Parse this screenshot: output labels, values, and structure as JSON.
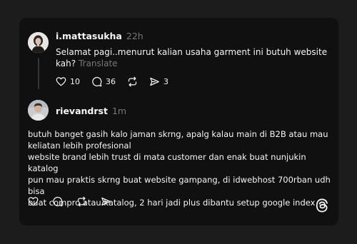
{
  "post1": {
    "username": "i.mattasukha",
    "time": "22h",
    "text_line1": "Selamat pagi..menurut kalian usaha garment ini butuh website",
    "text_line2": "kah?",
    "translate_label": "Translate",
    "likes": "10",
    "replies": "36",
    "shares": "3"
  },
  "post2": {
    "username": "rievandrst",
    "time": "1m",
    "text_lines": [
      "butuh banget gasih kalo jaman skrng, apalg kalau main di B2B atau mau",
      "keliatan lebih profesional",
      "website brand lebih trust di mata customer dan enak buat nunjukin katalog",
      "pun mau praktis skrng buat website gampang, di idwebhost 700rban udh bisa",
      "buat compro atau katalog, 2 hari jadi plus dibantu setup google index"
    ]
  },
  "icons": {
    "like": "heart-icon",
    "reply": "comment-icon",
    "repost": "repost-icon",
    "share": "send-icon",
    "logo": "threads-logo-icon"
  },
  "colors": {
    "background": "#1c1c1c",
    "card": "#101010",
    "text": "#f3f5f7",
    "muted": "#777777"
  }
}
